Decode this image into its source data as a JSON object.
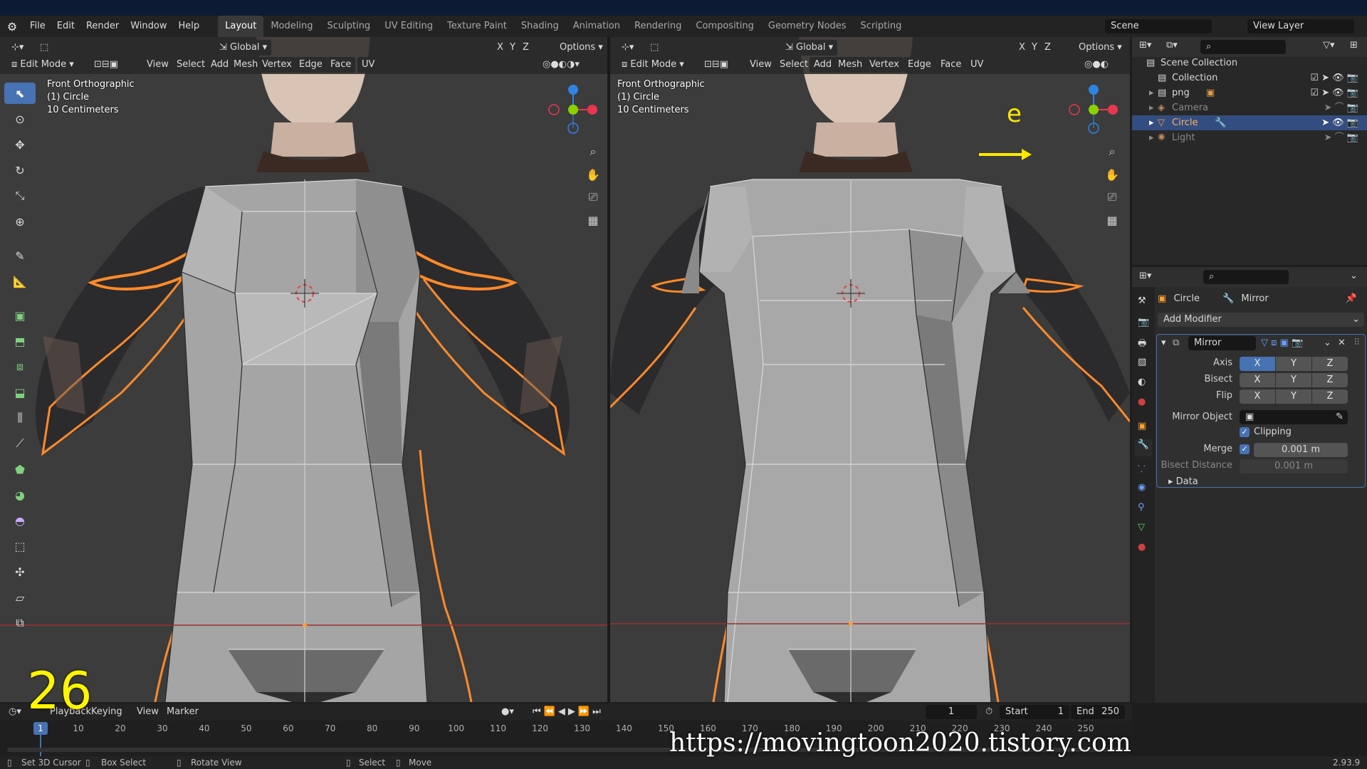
{
  "menu": {
    "items": [
      "File",
      "Edit",
      "Render",
      "Window",
      "Help"
    ],
    "workspaces": [
      "Layout",
      "Modeling",
      "Sculpting",
      "UV Editing",
      "Texture Paint",
      "Shading",
      "Animation",
      "Rendering",
      "Compositing",
      "Geometry Nodes",
      "Scripting"
    ],
    "active_workspace": "Layout",
    "scene_name": "Scene",
    "view_layer": "View Layer"
  },
  "viewport_left": {
    "mode": "Edit Mode",
    "transform_orientation": "Global",
    "options": "Options",
    "menus": [
      "View",
      "Select",
      "Add",
      "Mesh",
      "Vertex",
      "Edge",
      "Face",
      "UV"
    ],
    "axes": [
      "X",
      "Y",
      "Z"
    ],
    "overlay_lines": [
      "Front Orthographic",
      "(1) Circle",
      "10 Centimeters"
    ]
  },
  "viewport_right": {
    "mode": "Edit Mode",
    "transform_orientation": "Global",
    "options": "Options",
    "menus": [
      "View",
      "Select",
      "Add",
      "Mesh",
      "Vertex",
      "Edge",
      "Face",
      "UV"
    ],
    "axes": [
      "X",
      "Y",
      "Z"
    ],
    "overlay_lines": [
      "Front Orthographic",
      "(1) Circle",
      "10 Centimeters"
    ],
    "annotation_letter": "e"
  },
  "outliner": {
    "rows": [
      {
        "label": "Scene Collection",
        "icon": "scene-collection-icon"
      },
      {
        "label": "Collection",
        "icon": "collection-icon"
      },
      {
        "label": "png",
        "icon": "collection-icon"
      },
      {
        "label": "Camera",
        "icon": "camera-icon"
      },
      {
        "label": "Circle",
        "icon": "mesh-icon",
        "selected": true
      },
      {
        "label": "Light",
        "icon": "light-icon"
      }
    ]
  },
  "properties": {
    "object_name": "Circle",
    "modifier_name_header": "Mirror",
    "add_modifier": "Add Modifier",
    "modifier": {
      "name": "Mirror",
      "axis_label": "Axis",
      "bisect_label": "Bisect",
      "flip_label": "Flip",
      "axes": [
        "X",
        "Y",
        "Z"
      ],
      "axis_enabled": [
        true,
        false,
        false
      ],
      "mirror_object_label": "Mirror Object",
      "clipping_label": "Clipping",
      "clipping": true,
      "merge_label": "Merge",
      "merge_value": "0.001 m",
      "bisect_distance_label": "Bisect Distance",
      "bisect_distance_value": "0.001 m",
      "data_label": "Data"
    }
  },
  "timeline": {
    "playback": "Playback",
    "keying": "Keying",
    "view": "View",
    "marker": "Marker",
    "current_frame": "1",
    "start_label": "Start",
    "start": "1",
    "end_label": "End",
    "end": "250",
    "ticks": [
      "1",
      "10",
      "20",
      "30",
      "40",
      "50",
      "60",
      "70",
      "80",
      "90",
      "100",
      "110",
      "120",
      "130",
      "140",
      "150",
      "160",
      "170",
      "180",
      "190",
      "200",
      "210",
      "220",
      "230",
      "240",
      "250"
    ]
  },
  "status": {
    "items": [
      "Set 3D Cursor",
      "Box Select",
      "Rotate View",
      "Select",
      "Move"
    ],
    "version": "2.93.9"
  },
  "overlay": {
    "step_number": "26",
    "watermark_url": "https://movingtoon2020.tistory.com"
  },
  "colors": {
    "accent": "#4772b3",
    "selection_orange": "#ff8a2a",
    "annotation_yellow": "#ffe800",
    "axis_x": "#e8364f",
    "axis_y": "#8bd100",
    "axis_z": "#2f83e3"
  }
}
